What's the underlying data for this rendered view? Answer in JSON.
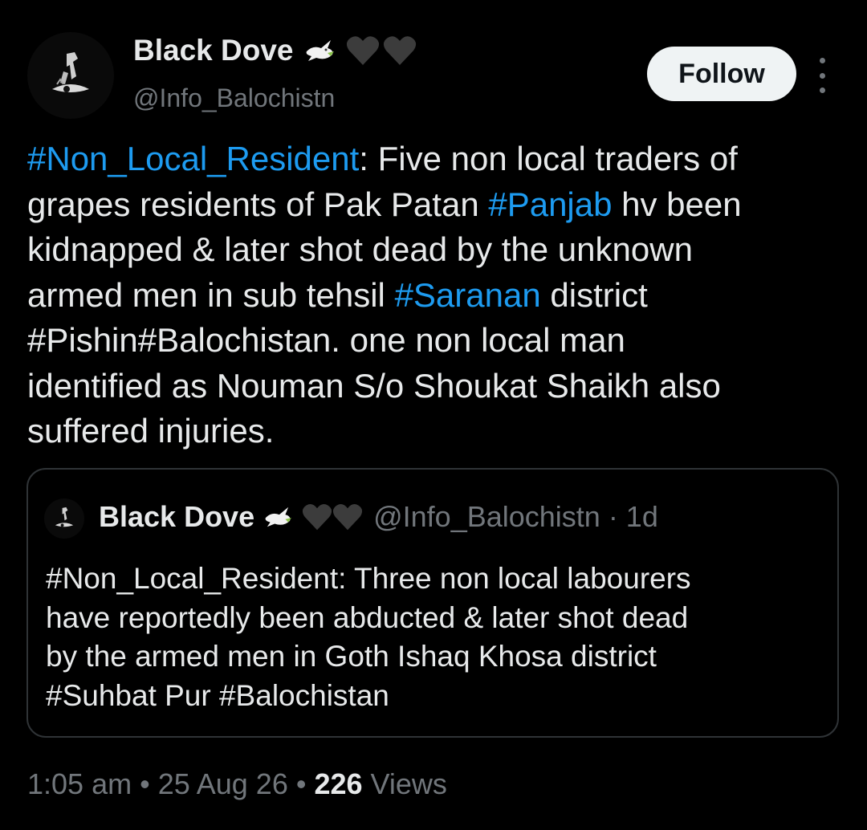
{
  "author": {
    "display_name": "Black Dove",
    "handle": "@Info_Balochistn",
    "emoji_icons": [
      "dove-icon",
      "black-heart-icon",
      "black-heart-icon"
    ]
  },
  "follow_label": "Follow",
  "tweet": {
    "lines": [
      [
        {
          "t": "#Non_Local_Resident",
          "tag": true
        },
        {
          "t": ": Five non local traders of",
          "tag": false
        }
      ],
      [
        {
          "t": "grapes residents of Pak Patan ",
          "tag": false
        },
        {
          "t": "#Panjab",
          "tag": true
        },
        {
          "t": " hv been",
          "tag": false
        }
      ],
      [
        {
          "t": "kidnapped & later shot dead by the unknown",
          "tag": false
        }
      ],
      [
        {
          "t": "armed men in sub tehsil ",
          "tag": false
        },
        {
          "t": "#Saranan",
          "tag": true
        },
        {
          "t": " district",
          "tag": false
        }
      ],
      [
        {
          "t": "#Pishin#Balochistan. one non local man",
          "tag": false
        }
      ],
      [
        {
          "t": "identified as Nouman S/o Shoukat Shaikh also",
          "tag": false
        }
      ],
      [
        {
          "t": "suffered injuries.",
          "tag": false
        }
      ]
    ]
  },
  "quoted": {
    "display_name": "Black Dove",
    "handle_time": "@Info_Balochistn · 1d",
    "lines": [
      "#Non_Local_Resident: Three non local labourers",
      "have reportedly been abducted & later shot dead",
      "by the armed men in Goth Ishaq Khosa district",
      "#Suhbat Pur #Balochistan"
    ]
  },
  "meta": {
    "time": "1:05 am",
    "sep1": " • ",
    "date": "25 Aug 26",
    "sep2": " • ",
    "views_count": "226",
    "views_label": "Views"
  },
  "colors": {
    "background": "#000000",
    "text": "#e7e9ea",
    "secondary": "#71767b",
    "link": "#1d9bf0",
    "border": "#2f3336"
  }
}
